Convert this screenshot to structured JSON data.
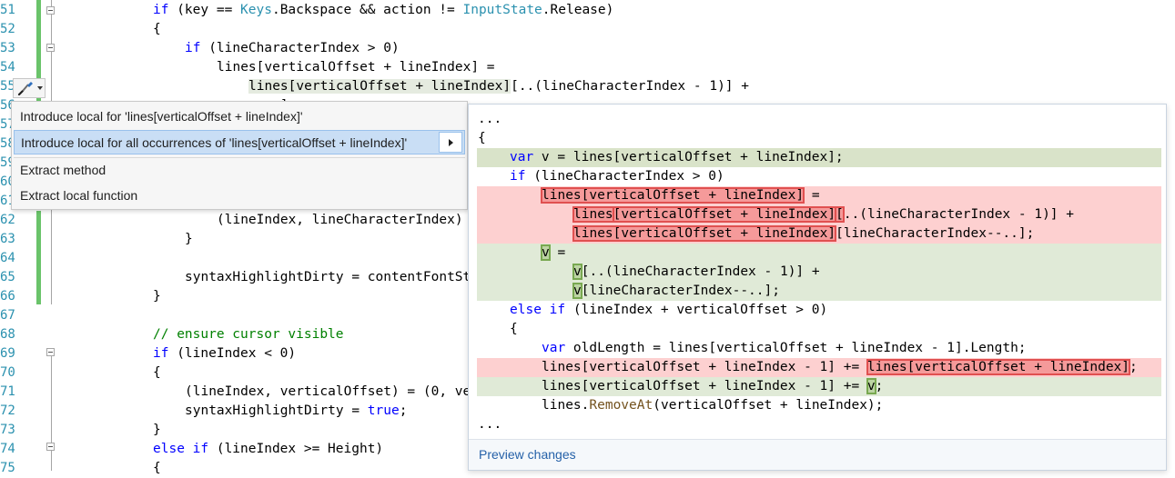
{
  "editor": {
    "lines": [
      {
        "num": "51",
        "top": 1
      },
      {
        "num": "52"
      },
      {
        "num": "53"
      },
      {
        "num": "54"
      },
      {
        "num": "55"
      },
      {
        "num": "56"
      },
      {
        "num": "57"
      },
      {
        "num": "58"
      },
      {
        "num": "59"
      },
      {
        "num": "60"
      },
      {
        "num": "61"
      },
      {
        "num": "62"
      },
      {
        "num": "63"
      },
      {
        "num": "64"
      },
      {
        "num": "65"
      },
      {
        "num": "66"
      },
      {
        "num": "67"
      },
      {
        "num": "68"
      },
      {
        "num": "69"
      },
      {
        "num": "70"
      },
      {
        "num": "71"
      },
      {
        "num": "72"
      },
      {
        "num": "73"
      },
      {
        "num": "74"
      },
      {
        "num": "75"
      }
    ],
    "code": {
      "l51_a": "if",
      "l51_b": " (key == ",
      "l51_c": "Keys",
      "l51_d": ".Backspace && action != ",
      "l51_e": "InputState",
      "l51_f": ".Release)",
      "l52": "{",
      "l53_a": "if",
      "l53_b": " (lineCharacterIndex > 0)",
      "l54": "lines[verticalOffset + lineIndex] =",
      "l55_a": "lines[verticalOffset + lineIndex]",
      "l55_b": "[..(lineCharacterIndex - 1)] +",
      "l56": "    ]",
      "l62": "(lineIndex, lineCharacterIndex)",
      "l63": "}",
      "l65": "syntaxHighlightDirty = contentFontSt",
      "l66": "}",
      "l68": "// ensure cursor visible",
      "l69_a": "if",
      "l69_b": " (lineIndex < 0)",
      "l70": "{",
      "l71_a": "(lineIndex, verticalOffset) = (0, ve",
      "l72_a": "syntaxHighlightDirty = ",
      "l72_b": "true",
      "l72_c": ";",
      "l73": "}",
      "l74_a": "else if",
      "l74_b": " (lineIndex >= Height)",
      "l75": "{"
    }
  },
  "menu": {
    "items": [
      "Introduce local for 'lines[verticalOffset + lineIndex]'",
      "Introduce local for all occurrences of 'lines[verticalOffset + lineIndex]'",
      "Extract method",
      "Extract local function"
    ]
  },
  "preview": {
    "l1": "...",
    "l2": "{",
    "l3_a": "var",
    "l3_b": " v = lines[verticalOffset + lineIndex];",
    "l4_a": "if",
    "l4_b": " (lineCharacterIndex > 0)",
    "l5_a": "lines[verticalOffset + lineIndex]",
    "l5_b": " =",
    "l6_a": "lines",
    "l6_b": "[verticalOffset + lineIndex]",
    "l6_c": "[",
    "l6_d": "..(lineCharacterIndex - 1)] +",
    "l7_a": "lines[verticalOffset + lineIndex]",
    "l7_b": "[lineCharacterIndex--..];",
    "l8_a": "v",
    "l8_b": " =",
    "l9_a": "v",
    "l9_b": "[..(lineCharacterIndex - 1)] +",
    "l10_a": "v",
    "l10_b": "[lineCharacterIndex--..];",
    "l11_a": "else if",
    "l11_b": " (lineIndex + verticalOffset > 0)",
    "l12": "{",
    "l13_a": "var",
    "l13_b": " oldLength = lines[verticalOffset + lineIndex - 1].Length;",
    "l14_a": "lines[verticalOffset + lineIndex - 1] += ",
    "l14_b": "lines[verticalOffset + lineIndex]",
    "l14_c": ";",
    "l15_a": "lines[verticalOffset + lineIndex - 1] += ",
    "l15_b": "v",
    "l15_c": ";",
    "l16_a": "lines.",
    "l16_b": "RemoveAt",
    "l16_c": "(verticalOffset + lineIndex);",
    "l17": "...",
    "footer_link": "Preview changes"
  }
}
